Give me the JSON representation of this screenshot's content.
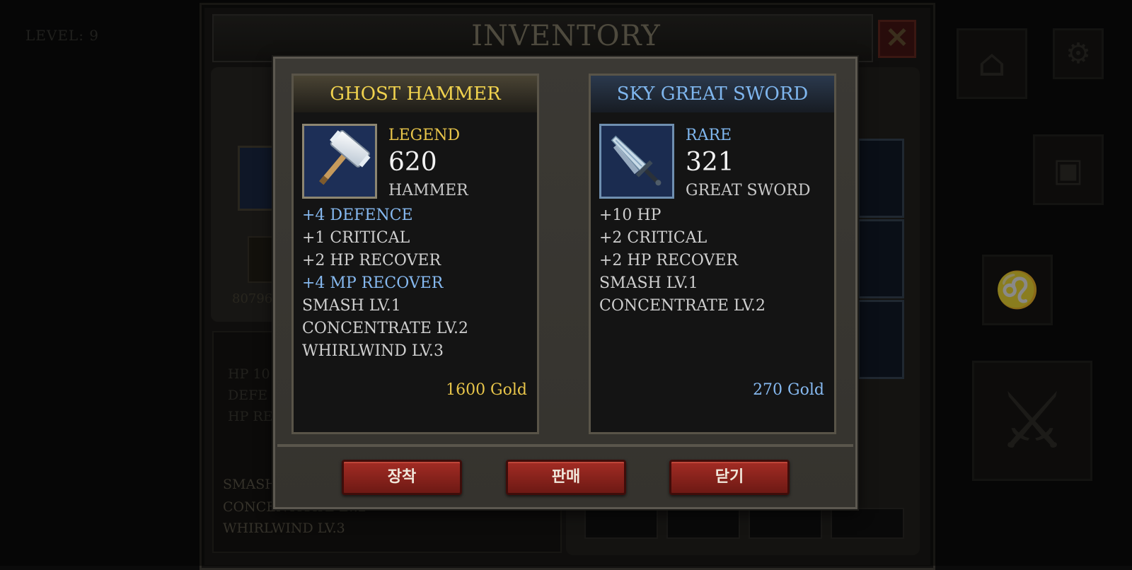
{
  "hud": {
    "level_label": "LEVEL:  9"
  },
  "inventory": {
    "title": "INVENTORY",
    "close_icon": "close-x-icon",
    "gold_partial": "80796",
    "stats_partial": [
      "HP 10",
      "DEFE",
      "HP RE"
    ],
    "skills_partial": [
      "SMASH",
      "CONCENTRATE LV.2",
      "WHIRLWIND LV.3"
    ]
  },
  "compare": {
    "left": {
      "name": "GHOST HAMMER",
      "grade": "LEGEND",
      "power": "620",
      "type": "HAMMER",
      "icon": "hammer-icon",
      "stats": [
        {
          "text": "+4 DEFENCE",
          "highlight": true
        },
        {
          "text": "+1 CRITICAL",
          "highlight": false
        },
        {
          "text": "+2 HP RECOVER",
          "highlight": false
        },
        {
          "text": "+4 MP RECOVER",
          "highlight": true
        },
        {
          "text": "SMASH LV.1",
          "highlight": false
        },
        {
          "text": "CONCENTRATE LV.2",
          "highlight": false
        },
        {
          "text": "WHIRLWIND LV.3",
          "highlight": false
        }
      ],
      "price": "1600 Gold"
    },
    "right": {
      "name": "SKY GREAT SWORD",
      "grade": "RARE",
      "power": "321",
      "type": "GREAT SWORD",
      "icon": "great-sword-icon",
      "stats": [
        {
          "text": "+10 HP",
          "highlight": false
        },
        {
          "text": "+2 CRITICAL",
          "highlight": false
        },
        {
          "text": "+2 HP RECOVER",
          "highlight": false
        },
        {
          "text": "SMASH LV.1",
          "highlight": false
        },
        {
          "text": "CONCENTRATE LV.2",
          "highlight": false
        }
      ],
      "price": "270 Gold"
    }
  },
  "buttons": {
    "equip": "장착",
    "sell": "판매",
    "close": "닫기"
  },
  "side_icons": [
    "shop-basket-icon",
    "gear-icon",
    "backpack-icon",
    "lion-icon",
    "crossed-swords-icon"
  ],
  "colors": {
    "legend": "#e8c54a",
    "rare": "#7fb6ee",
    "button": "#8f231c"
  }
}
